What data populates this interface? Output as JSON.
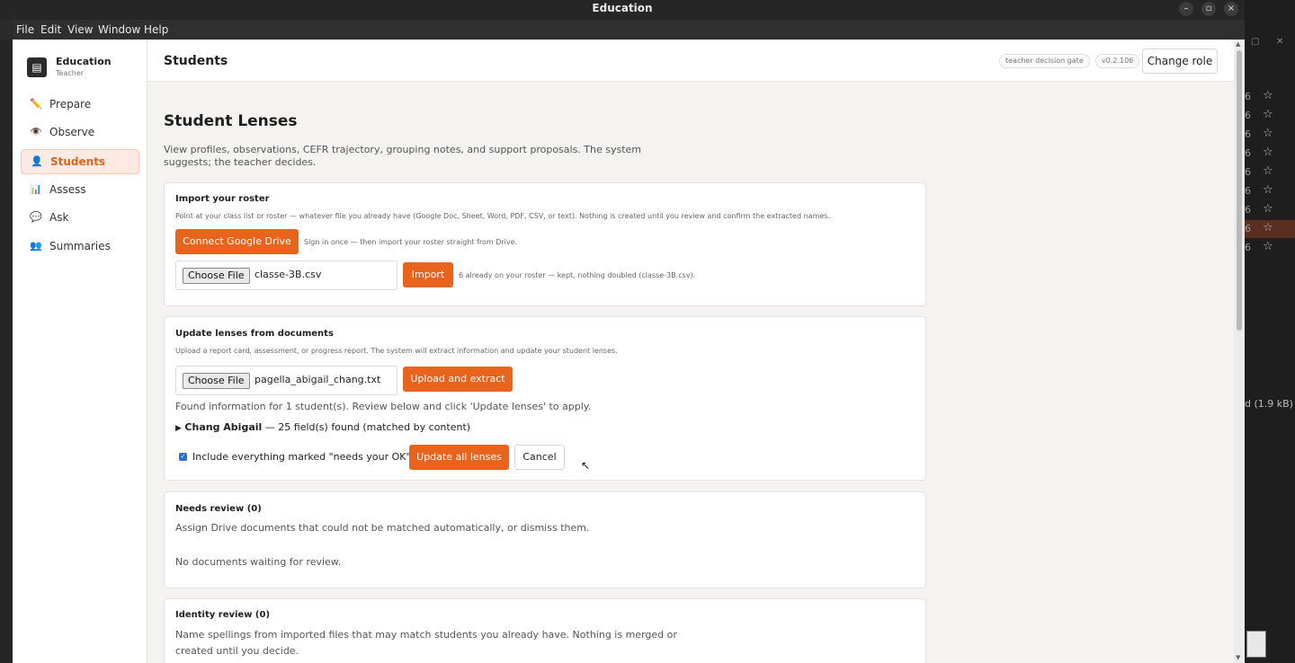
{
  "window": {
    "title": "Education",
    "controls": {
      "minimize": "–",
      "maximize": "▫",
      "close": "×"
    }
  },
  "menu": [
    "File",
    "Edit",
    "View",
    "Window",
    "Help"
  ],
  "brand": {
    "name": "Education",
    "role": "Teacher",
    "icon": "board-icon"
  },
  "nav": [
    {
      "label": "Prepare",
      "icon": "pencil-icon",
      "glyph": "✏️"
    },
    {
      "label": "Observe",
      "icon": "eye-icon",
      "glyph": "👁️"
    },
    {
      "label": "Students",
      "icon": "user-icon",
      "glyph": "👤",
      "active": true
    },
    {
      "label": "Assess",
      "icon": "bar-chart-icon",
      "glyph": "📊"
    },
    {
      "label": "Ask",
      "icon": "chat-icon",
      "glyph": "💬"
    },
    {
      "label": "Summaries",
      "icon": "people-icon",
      "glyph": "👥"
    }
  ],
  "header": {
    "title": "Students",
    "gate_pill": "teacher decision gate",
    "version_pill": "v0.2.106",
    "change_role": "Change role"
  },
  "page": {
    "title": "Student Lenses",
    "description": "View profiles, observations, CEFR trajectory, grouping notes, and support proposals. The system suggests; the teacher decides."
  },
  "roster": {
    "title": "Import your roster",
    "subtitle": "Point at your class list or roster — whatever file you already have (Google Doc, Sheet, Word, PDF, CSV, or text). Nothing is created until you review and confirm the extracted names.",
    "connect_drive": "Connect Google Drive",
    "connect_note": "Sign in once — then import your roster straight from Drive.",
    "choose_file": "Choose File",
    "file_name": "classe-3B.csv",
    "import": "Import",
    "import_note": "6 already on your roster — kept, nothing doubled (classe-3B.csv)."
  },
  "update": {
    "title": "Update lenses from documents",
    "subtitle": "Upload a report card, assessment, or progress report. The system will extract information and update your student lenses.",
    "choose_file": "Choose File",
    "file_name": "pagella_abigail_chang.txt",
    "upload": "Upload and extract",
    "found": "Found information for 1 student(s). Review below and click 'Update lenses' to apply.",
    "student_name": "Chang Abigail",
    "student_detail": " — 25 field(s) found (matched by content)",
    "include_label": "Include everything marked \"needs your OK\"",
    "update_all": "Update all lenses",
    "cancel": "Cancel"
  },
  "needs_review": {
    "title": "Needs review (0)",
    "subtitle": "Assign Drive documents that could not be matched automatically, or dismiss them.",
    "empty": "No documents waiting for review."
  },
  "identity_review": {
    "title": "Identity review (0)",
    "line1": "Name spellings from imported files that may match students you already have. Nothing is merged or",
    "line2": "created until you decide."
  },
  "background_window": {
    "rows": [
      {
        "num": "6",
        "star": "☆"
      },
      {
        "num": "6",
        "star": "☆"
      },
      {
        "num": "6",
        "star": "☆"
      },
      {
        "num": "6",
        "star": "☆"
      },
      {
        "num": "6",
        "star": "☆"
      },
      {
        "num": "6",
        "star": "☆"
      },
      {
        "num": "6",
        "star": "☆"
      },
      {
        "num": "6",
        "star": "☆",
        "active": true
      },
      {
        "num": "6",
        "star": "☆"
      }
    ],
    "size_label": "d (1.9 kB)"
  }
}
